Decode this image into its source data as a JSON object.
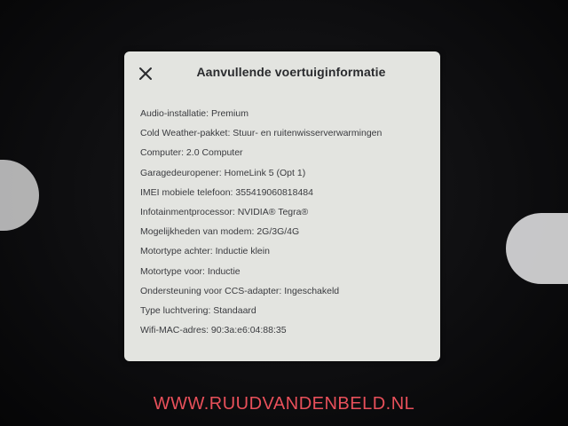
{
  "dialog": {
    "title": "Aanvullende voertuiginformatie",
    "close_icon": "close-icon",
    "items": [
      "Audio-installatie: Premium",
      "Cold Weather-pakket: Stuur- en ruitenwisserverwarmingen",
      "Computer: 2.0 Computer",
      "Garagedeuropener: HomeLink 5 (Opt 1)",
      "IMEI mobiele telefoon: 355419060818484",
      "Infotainmentprocessor: NVIDIA® Tegra®",
      "Mogelijkheden van modem: 2G/3G/4G",
      "Motortype achter: Inductie klein",
      "Motortype voor: Inductie",
      "Ondersteuning voor CCS-adapter: Ingeschakeld",
      "Type luchtvering: Standaard",
      "Wifi-MAC-adres: 90:3a:e6:04:88:35"
    ]
  },
  "watermark": {
    "text": "WWW.RUUDVANDENBELD.NL",
    "color": "#e8505a"
  },
  "colors": {
    "dialog_bg": "#e3e4e0",
    "text": "#3a3b3f",
    "title": "#2a2b2e"
  }
}
